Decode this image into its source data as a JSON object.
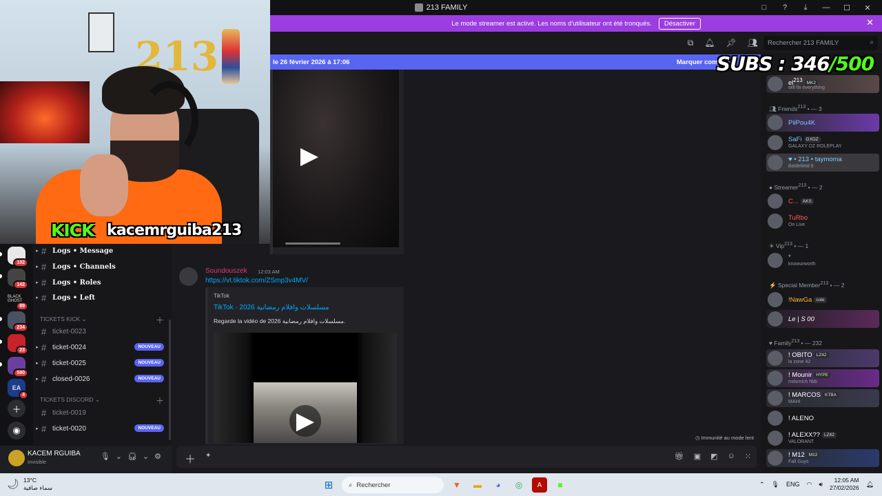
{
  "window": {
    "title": "213 FAMILY",
    "controls": [
      "□",
      "?",
      "⤓",
      "—",
      "☐",
      "✕"
    ]
  },
  "streamer_banner": {
    "text": "Le mode streamer est activé. Les noms d'utilisateur ont été tronqués.",
    "button": "Désactiver",
    "close": "✕"
  },
  "header": {
    "search_placeholder": "Rechercher 213 FAMILY"
  },
  "new_messages": {
    "text": "le 26 février 2026 à 17:06",
    "mark": "Marquer comme"
  },
  "webcam": {
    "platform": "KICK",
    "username": "kacemrguiba213",
    "balloons": "213"
  },
  "subs": {
    "label": "SUBS : ",
    "count": "346",
    "goal": "/500"
  },
  "message": {
    "author": "Soundouszek",
    "time": "12:03 AM",
    "link": "https://vt.tiktok.com/ZSmp3v4MV/",
    "embed": {
      "provider": "TikTok",
      "title": "TikTok · 2026 مسلسلات وافلام رمضانية",
      "description": "Regarde la vidéo de 2026 مسلسلات وافلام رمضانية."
    }
  },
  "immunity": "Immunité au mode lent",
  "servers": [
    {
      "badge": "102",
      "label": ""
    },
    {
      "badge": "142",
      "label": ""
    },
    {
      "badge": "89",
      "label": "BLACK GHOST"
    },
    {
      "badge": "234",
      "label": ""
    },
    {
      "badge": "23",
      "label": ""
    },
    {
      "badge": "590",
      "label": ""
    },
    {
      "badge": "4",
      "label": "EA"
    }
  ],
  "channels": {
    "logs": [
      "Logs • Message",
      "Logs • Channels",
      "Logs • Roles",
      "Logs • Left"
    ],
    "cat_kick": "TICKETS KICK",
    "kick_tickets": [
      {
        "name": "ticket-0023",
        "badge": ""
      },
      {
        "name": "ticket-0024",
        "badge": "NOUVEAU"
      },
      {
        "name": "ticket-0025",
        "badge": "NOUVEAU"
      },
      {
        "name": "closed-0026",
        "badge": "NOUVEAU"
      }
    ],
    "cat_discord": "TICKETS DISCORD",
    "discord_tickets": [
      {
        "name": "ticket-0019",
        "badge": ""
      },
      {
        "name": "ticket-0020",
        "badge": "NOUVEAU"
      }
    ]
  },
  "user": {
    "name": "KACEM RGUIBA",
    "status": "Invisible"
  },
  "members": {
    "top": {
      "name": "el",
      "sup": "213",
      "tag": "MK2",
      "activity": "will fix everything"
    },
    "groups": [
      {
        "title": "Friends",
        "sup": "213",
        "count": "— 3"
      },
      {
        "title": "Streamer",
        "sup": "213",
        "count": "— 2"
      },
      {
        "title": "Vip",
        "sup": "213",
        "count": "— 1"
      },
      {
        "title": "Special Member",
        "sup": "213",
        "count": "— 2"
      },
      {
        "title": "Family",
        "sup": "213",
        "count": "— 232"
      }
    ],
    "list": [
      {
        "name": "PiiPou4K",
        "tag": "",
        "activity": "",
        "color": "#7ec8ff"
      },
      {
        "name": "SaFi",
        "tag": "GXDZ",
        "activity": "GALAXY DZ ROLEPLAY",
        "color": "#7ec8ff"
      },
      {
        "name": "♥ • 213 • taymoma",
        "tag": "",
        "activity": "Battlefield 6",
        "color": "#7ec8ff"
      },
      {
        "name": "C...",
        "tag": "AKS",
        "activity": "",
        "color": "#ff5c5c"
      },
      {
        "name": "TuRbo",
        "tag": "",
        "activity": "On Live",
        "color": "#ff5c5c"
      },
      {
        "name": "*",
        "tag": "",
        "activity": "knowurworth",
        "color": "#7ec8ff"
      },
      {
        "name": "!NawGa",
        "tag": "cute",
        "activity": "",
        "color": "#ffb347"
      },
      {
        "name": "Le | S 00",
        "tag": "",
        "activity": "",
        "color": "#ffffff"
      },
      {
        "name": "! OBITO",
        "tag": "LZ42",
        "activity": "la zone 42",
        "color": "#ffffff"
      },
      {
        "name": "! Mounir",
        "tag": "HYPE",
        "activity": "mdsrnich hbb",
        "color": "#ffffff"
      },
      {
        "name": "! MARCOS",
        "tag": "KTBA",
        "activity": "MAHI",
        "color": "#ffffff"
      },
      {
        "name": "! ALENO",
        "tag": "",
        "activity": "",
        "color": "#ffffff"
      },
      {
        "name": "! ALEXX??",
        "tag": "LZ42",
        "activity": "VALORANT",
        "color": "#ffffff"
      },
      {
        "name": "! M12",
        "tag": "M12",
        "activity": "Fall Guys",
        "color": "#ffffff"
      }
    ]
  },
  "taskbar": {
    "temp": "13°C",
    "weather": "سماء صافية",
    "search": "Rechercher",
    "lang": "ENG",
    "time": "12:05 AM",
    "date": "27/02/2026"
  }
}
